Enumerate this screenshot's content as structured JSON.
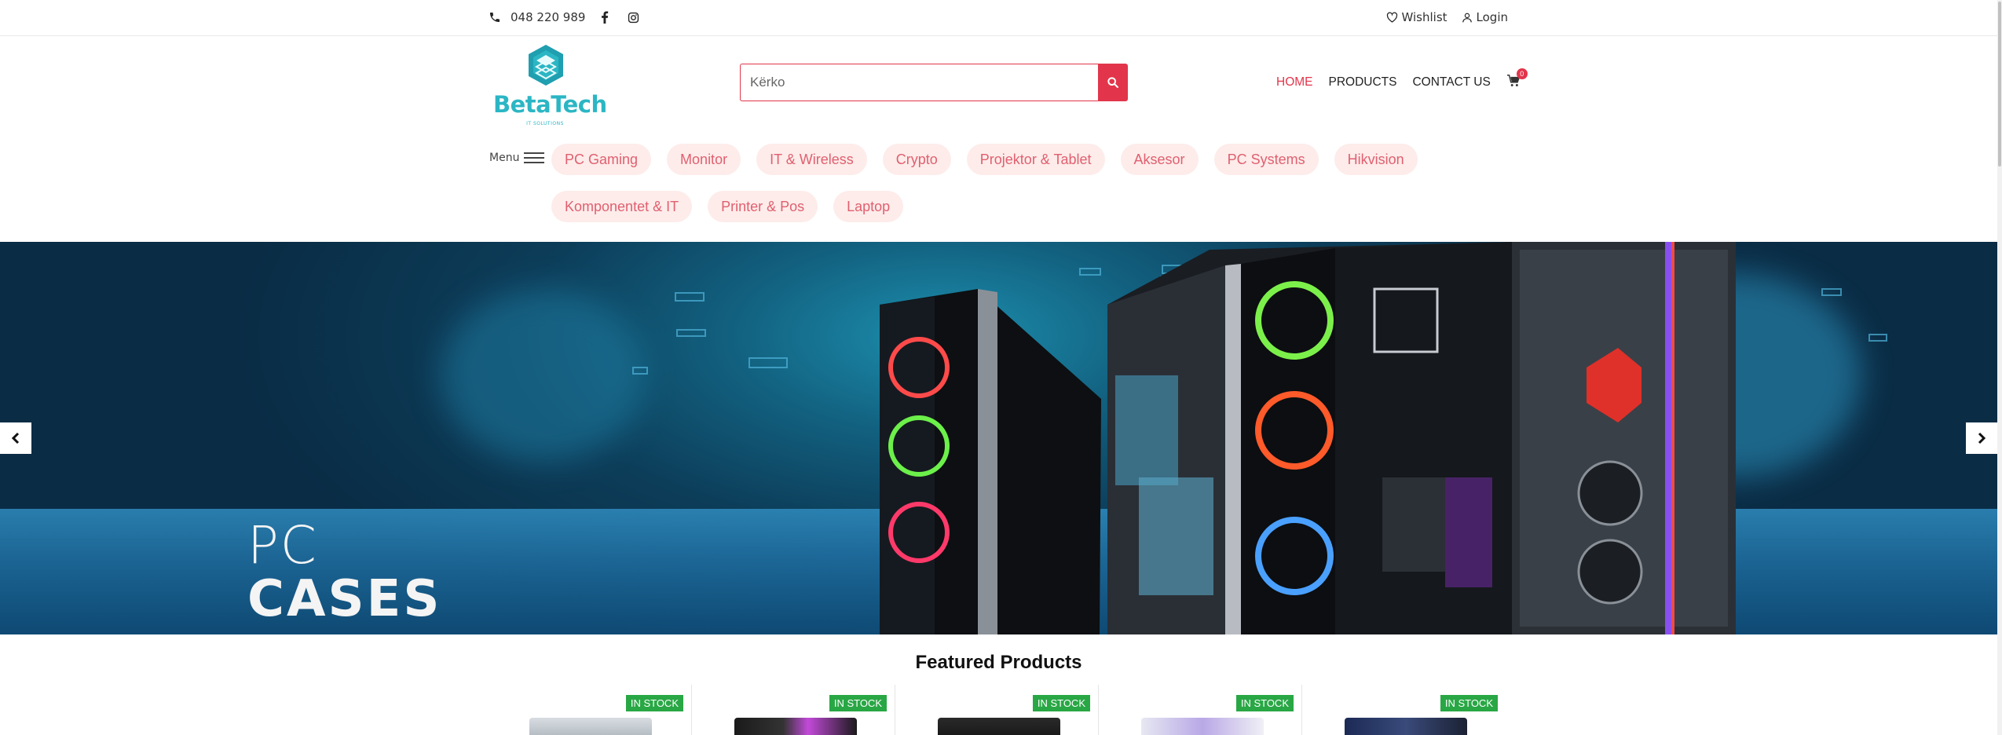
{
  "topbar": {
    "phone": "048 220 989",
    "wishlist": "Wishlist",
    "login": "Login"
  },
  "brand": {
    "name": "BetaTech",
    "tagline": "IT SOLUTIONS",
    "color": "#2bb6c4"
  },
  "search": {
    "placeholder": "Kërko"
  },
  "nav": {
    "home": "HOME",
    "products": "PRODUCTS",
    "contact": "CONTACT US",
    "cart_count": "0"
  },
  "menu": {
    "label": "Menu",
    "categories": [
      "PC Gaming",
      "Monitor",
      "IT & Wireless",
      "Crypto",
      "Projektor & Tablet",
      "Aksesor",
      "PC Systems",
      "Hikvision",
      "Komponentet & IT",
      "Printer & Pos",
      "Laptop"
    ]
  },
  "banner": {
    "line1": "PC",
    "line2": "CASES"
  },
  "featured": {
    "title": "Featured Products",
    "products": [
      {
        "stock": "IN STOCK"
      },
      {
        "stock": "IN STOCK"
      },
      {
        "stock": "IN STOCK"
      },
      {
        "stock": "IN STOCK"
      },
      {
        "stock": "IN STOCK"
      }
    ]
  },
  "colors": {
    "accent": "#e2354b",
    "stock_badge": "#29a745",
    "category_bg": "#fdecea",
    "category_text": "#e06070"
  }
}
